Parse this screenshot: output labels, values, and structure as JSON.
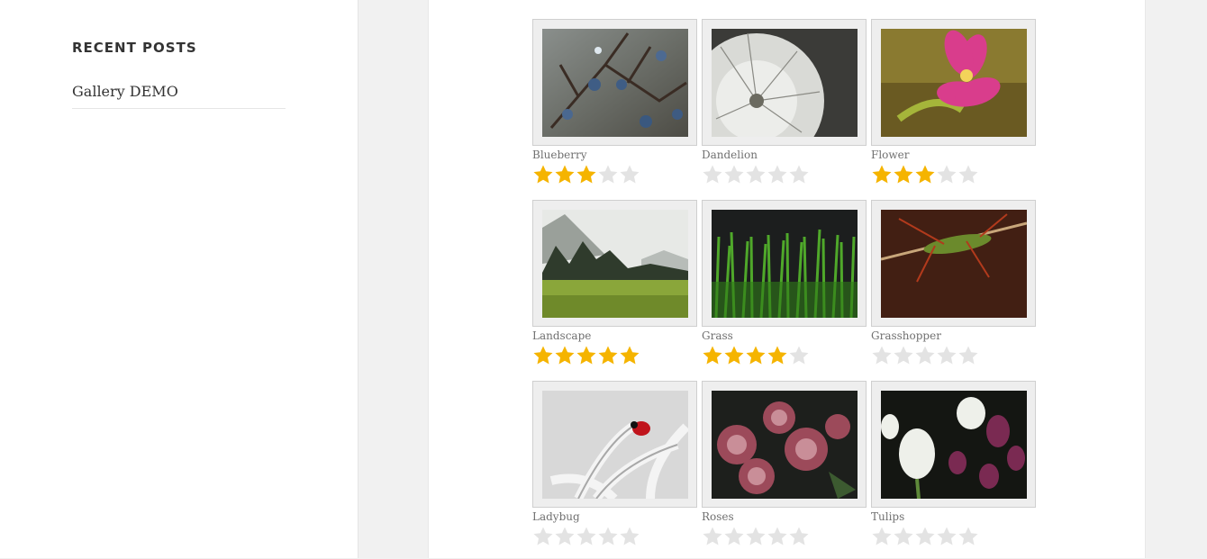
{
  "sidebar": {
    "widget_title": "RECENT POSTS",
    "posts": [
      "Gallery DEMO"
    ]
  },
  "gallery": {
    "star_max": 5,
    "star_on_color": "#f5b400",
    "star_off_color": "#e3e3e3",
    "items": [
      {
        "caption": "Blueberry",
        "rating": 3,
        "image": "blueberry-branch"
      },
      {
        "caption": "Dandelion",
        "rating": 0,
        "image": "dandelion-seedhead"
      },
      {
        "caption": "Flower",
        "rating": 3,
        "image": "pink-flower"
      },
      {
        "caption": "Landscape",
        "rating": 5,
        "image": "mountain-meadow"
      },
      {
        "caption": "Grass",
        "rating": 4,
        "image": "green-grass"
      },
      {
        "caption": "Grasshopper",
        "rating": 0,
        "image": "grasshopper"
      },
      {
        "caption": "Ladybug",
        "rating": 0,
        "image": "ladybug"
      },
      {
        "caption": "Roses",
        "rating": 0,
        "image": "roses"
      },
      {
        "caption": "Tulips",
        "rating": 0,
        "image": "tulips"
      }
    ]
  }
}
